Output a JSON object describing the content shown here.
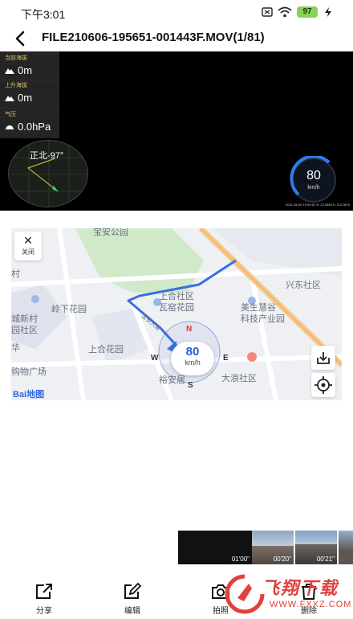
{
  "status_bar": {
    "time": "下午3:01",
    "battery": "97"
  },
  "header": {
    "title": "FILE210606-195651-001443F.MOV(1/81)"
  },
  "video": {
    "altitude_label": "当前海拔",
    "altitude_value": "0m",
    "climb_label": "上升海拔",
    "climb_value": "0m",
    "pressure_label": "气压",
    "pressure_value": "0.0hPa",
    "heading": "正北-97°",
    "speed": "80",
    "speed_unit": "km/h",
    "overlay_info": "2021-06-06 19:56:51  N: 22.5880  E: 113.9870"
  },
  "map": {
    "close_label": "关闭",
    "pois": [
      "宝安公园",
      "兴东社区",
      "上合社区",
      "瓦窑花园",
      "岭下花园",
      "美生慧谷",
      "科技产业园",
      "城新村",
      "园社区",
      "上合花园",
      "购物广场",
      "裕安居",
      "大浪社区",
      "村",
      "华"
    ],
    "road_label": "宝安大道",
    "speed": "80",
    "speed_unit": "km/h",
    "compass": {
      "n": "N",
      "s": "S",
      "e": "E",
      "w": "W"
    },
    "brand": "Bai地图",
    "colors": {
      "route": "#3a6fe0",
      "highway": "#f6c88a",
      "park": "#cfe9c9"
    }
  },
  "thumbnails": [
    {
      "time": "01'00\""
    },
    {
      "time": "00'20\""
    },
    {
      "time": "00'21\""
    }
  ],
  "toolbar": {
    "share_label": "分享",
    "edit_label": "编辑",
    "capture_label": "拍照",
    "delete_label": "删除"
  },
  "watermark": {
    "title": "飞翔下载",
    "url": "WWW.FXXZ.COM"
  }
}
